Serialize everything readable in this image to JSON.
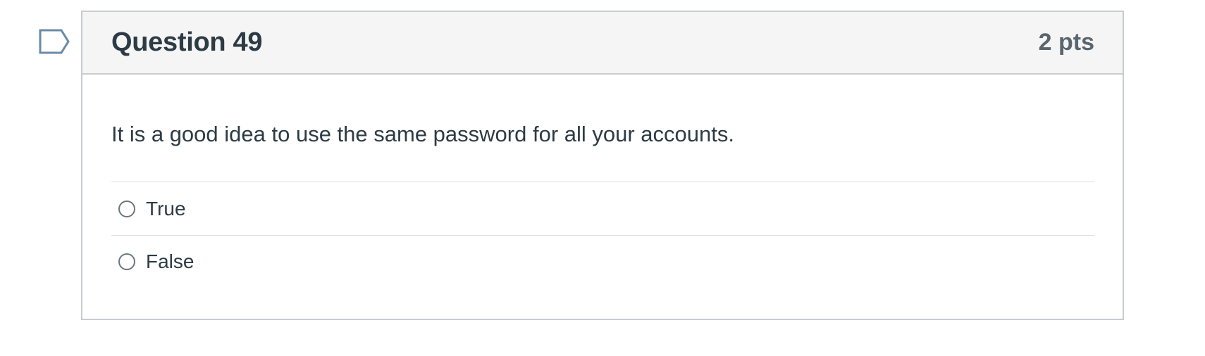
{
  "question": {
    "title": "Question 49",
    "points": "2 pts",
    "text": "It is a good idea to use the same password for all your accounts.",
    "answers": [
      {
        "label": "True",
        "selected": false
      },
      {
        "label": "False",
        "selected": false
      }
    ]
  },
  "icons": {
    "flag": "flag-question-icon"
  },
  "colors": {
    "header_background": "#f5f5f5",
    "border": "#c7cdd1",
    "text": "#2d3b45",
    "points_text": "#5a6570",
    "flag_outline": "#6b8aa8"
  }
}
